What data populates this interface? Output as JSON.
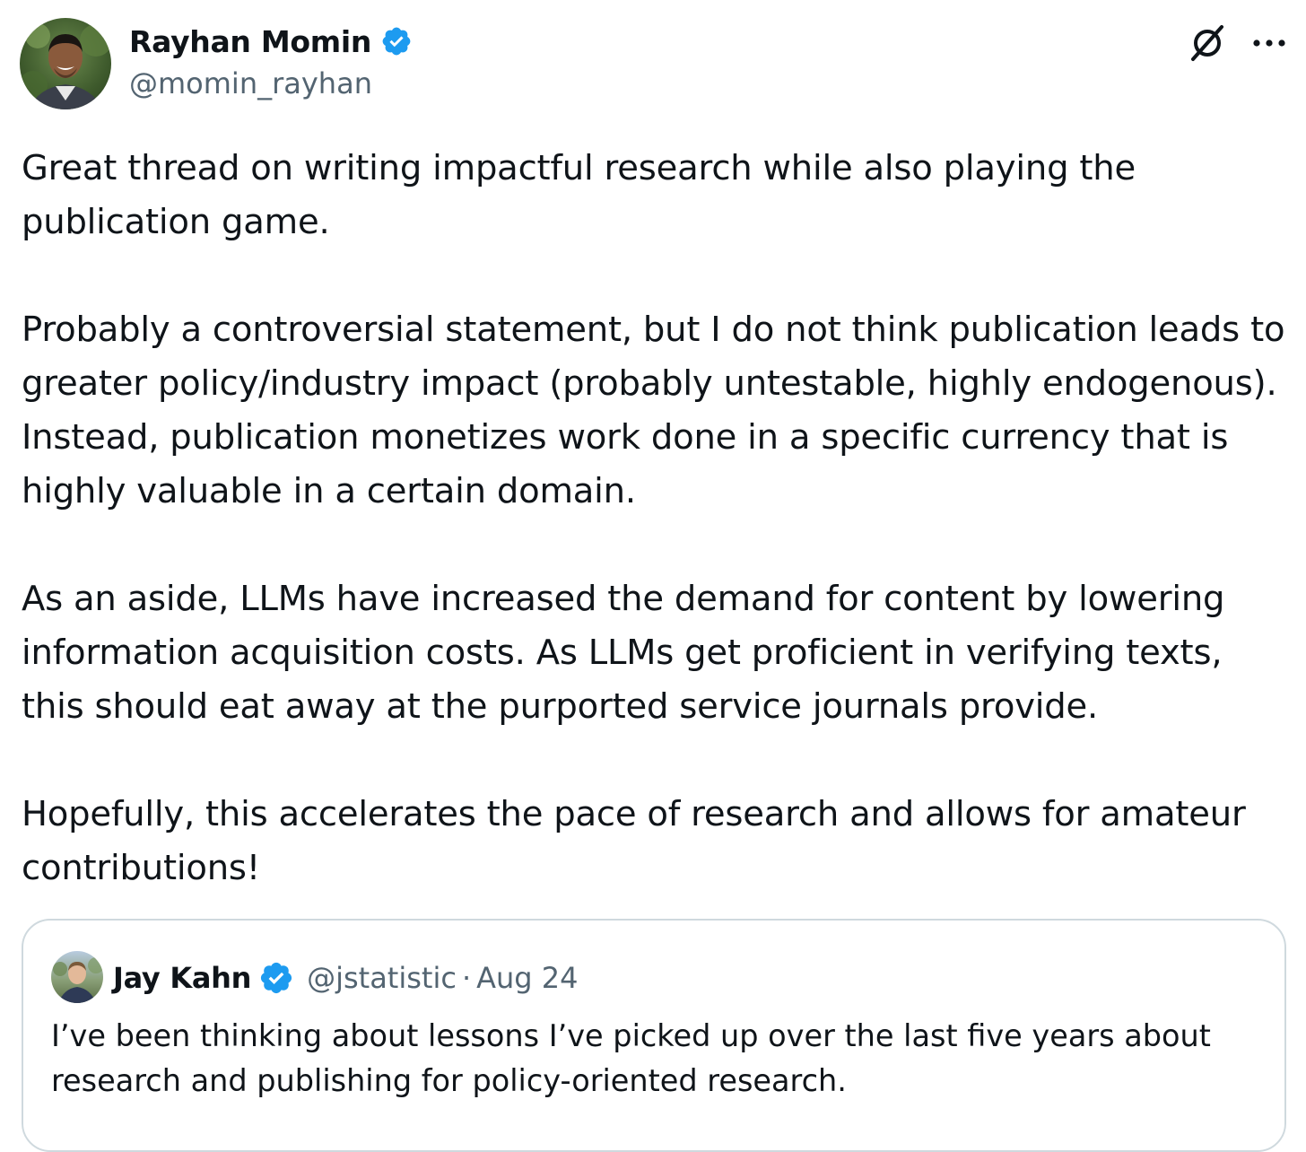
{
  "author": {
    "name": "Rayhan Momin",
    "handle": "@momin_rayhan",
    "verified": true,
    "avatar_icon": "user-avatar"
  },
  "actions": {
    "grok_icon": "grok-icon",
    "more_icon": "more-options-icon"
  },
  "tweet": {
    "paragraphs": [
      "Great thread on writing impactful research while also playing the publication game.",
      "Probably a controversial statement, but I do not think publication leads to greater policy/industry impact (probably untestable, highly endogenous). Instead, publication monetizes work done in a specific currency that is highly valuable in a certain domain.",
      "As an aside, LLMs have increased the demand for content by lowering information acquisition costs. As LLMs get proficient in verifying texts, this should eat away at the purported service journals provide.",
      "Hopefully, this accelerates the pace of research and allows for amateur contributions!"
    ]
  },
  "quoted_tweet": {
    "name": "Jay Kahn",
    "handle": "@jstatistic",
    "separator": "·",
    "date": "Aug 24",
    "verified": true,
    "text": "I’ve been thinking about lessons I’ve picked up over the last five years about research and publishing for policy-oriented research."
  },
  "colors": {
    "text_primary": "#0f1419",
    "text_secondary": "#536471",
    "verified_blue": "#1d9bf0",
    "border": "#cfd9de"
  }
}
